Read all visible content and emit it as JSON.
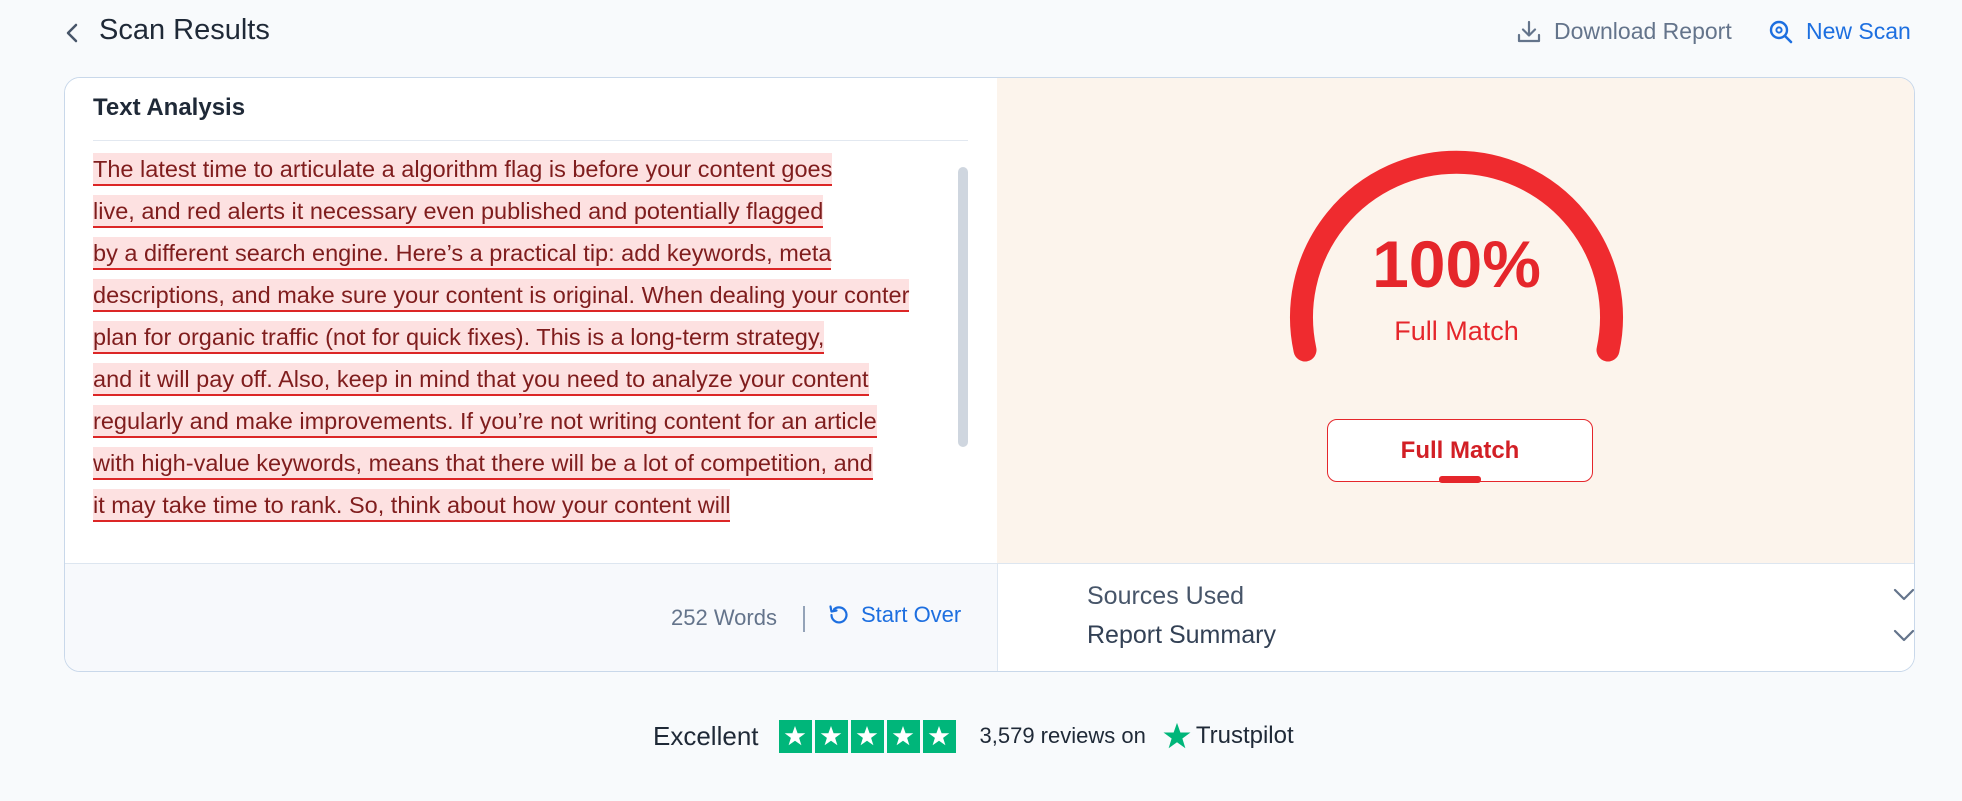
{
  "header": {
    "title": "Scan Results",
    "download_label": "Download Report",
    "new_scan_label": "New Scan"
  },
  "text_analysis": {
    "title": "Text Analysis",
    "lines": [
      [
        "The latest time to articulate a algorithm flag is before your content goes"
      ],
      [
        "live, and red alerts it necessary even published and potentially flagged"
      ],
      [
        "by a different search engine. Here’s a practical tip: add keywords, meta"
      ],
      [
        "descriptions, and make sure your content is original.",
        " When dealing your conter"
      ],
      [
        "plan for organic traffic (not for quick fixes). This is a long-term strategy,"
      ],
      [
        "and it will pay off.",
        " Also, keep in mind that you need to analyze your content"
      ],
      [
        "regularly and make improvements. If you’re not writing content for an article"
      ],
      [
        "with high-value keywords, means that there will be a lot of competition, and"
      ],
      [
        "it may take time to rank.",
        " So, think about how your content will"
      ]
    ],
    "word_count": "252 Words",
    "start_over_label": "Start Over"
  },
  "result": {
    "percent_text": "100%",
    "percent_value": 100,
    "match_label": "Full Match",
    "match_button_label": "Full Match",
    "accent_color": "#e5262b"
  },
  "accordion": {
    "sources_label": "Sources Used",
    "summary_label": "Report Summary"
  },
  "footer": {
    "rating_word": "Excellent",
    "stars": 5,
    "reviews_text": "3,579 reviews on",
    "brand": "Trustpilot",
    "brand_color": "#00b67a"
  }
}
